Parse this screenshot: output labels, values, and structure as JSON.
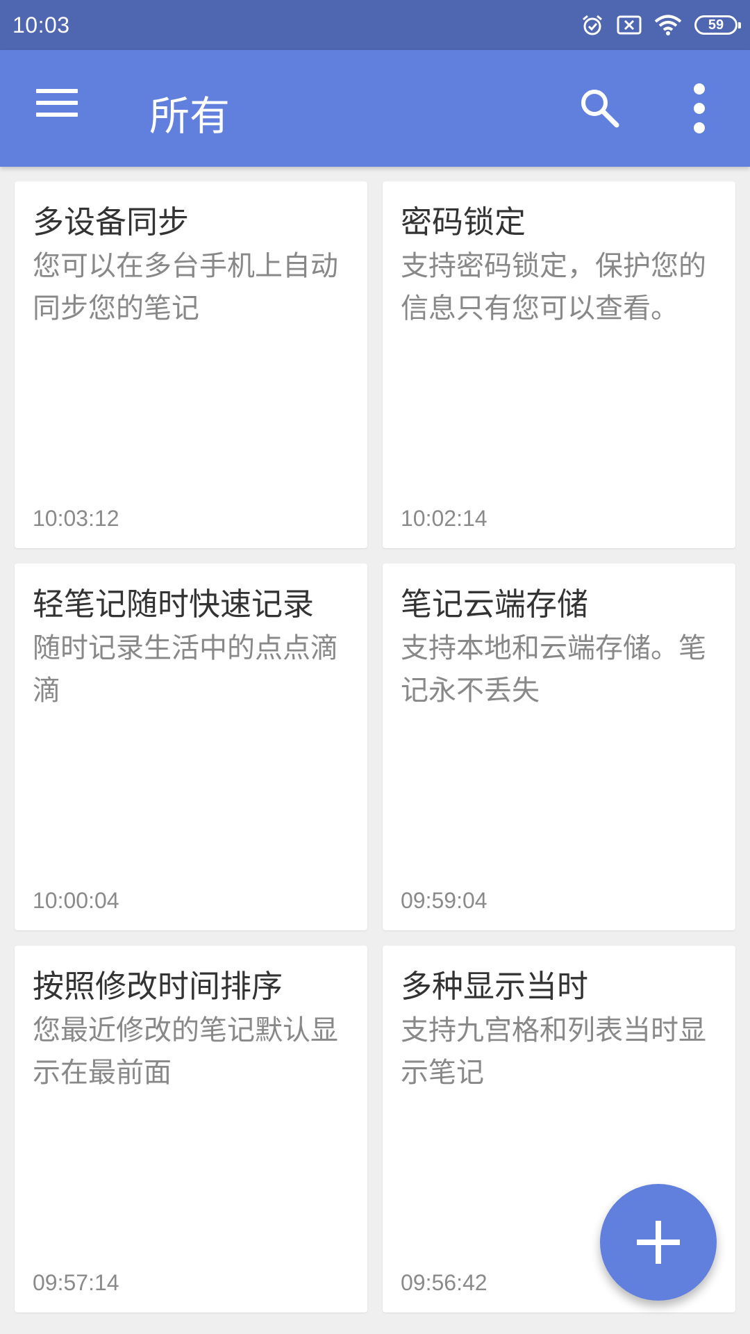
{
  "status_bar": {
    "time": "10:03",
    "battery": "59",
    "icons": [
      "alarm-icon",
      "sim-error-icon",
      "wifi-icon",
      "battery-icon"
    ]
  },
  "app_bar": {
    "title": "所有",
    "icons": [
      "menu-icon",
      "search-icon",
      "more-vert-icon"
    ],
    "color": "#6180dd"
  },
  "notes": [
    {
      "title": "多设备同步",
      "body": "您可以在多台手机上自动同步您的笔记",
      "time": "10:03:12"
    },
    {
      "title": "密码锁定",
      "body": "支持密码锁定，保护您的信息只有您可以查看。",
      "time": "10:02:14"
    },
    {
      "title": "轻笔记随时快速记录",
      "body": "随时记录生活中的点点滴滴",
      "time": "10:00:04"
    },
    {
      "title": "笔记云端存储",
      "body": "支持本地和云端存储。笔记永不丢失",
      "time": "09:59:04"
    },
    {
      "title": "按照修改时间排序",
      "body": "您最近修改的笔记默认显示在最前面",
      "time": "09:57:14"
    },
    {
      "title": "多种显示当时",
      "body": "支持九宫格和列表当时显示笔记",
      "time": "09:56:42"
    }
  ],
  "fab": {
    "icon": "add-icon",
    "color": "#6180dd"
  }
}
